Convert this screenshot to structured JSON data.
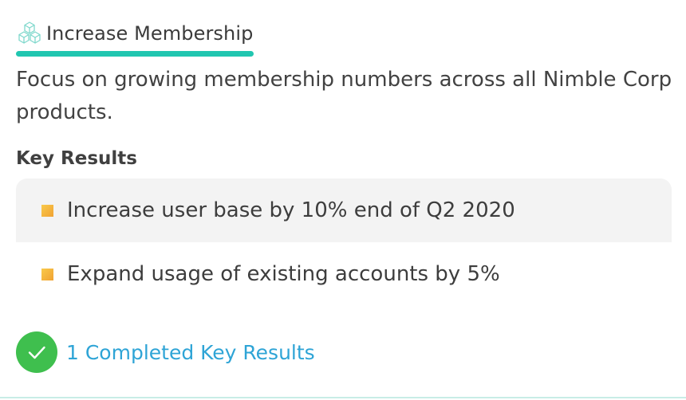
{
  "objective": {
    "title": "Increase Membership",
    "icon": "cubes-icon",
    "accent_color": "#21c6b0",
    "description": "Focus on growing membership numbers across all Nimble Corp products."
  },
  "key_results": {
    "heading": "Key Results",
    "bullet_color": "#f0a233",
    "items": [
      {
        "label": "Increase user base by 10% end of Q2 2020",
        "highlighted": true
      },
      {
        "label": "Expand usage of existing accounts by 5%",
        "highlighted": false
      }
    ]
  },
  "completed": {
    "label": "1 Completed Key Results",
    "icon": "checkmark-icon",
    "icon_color": "#3fbf4e",
    "link_color": "#2ea4d6"
  }
}
